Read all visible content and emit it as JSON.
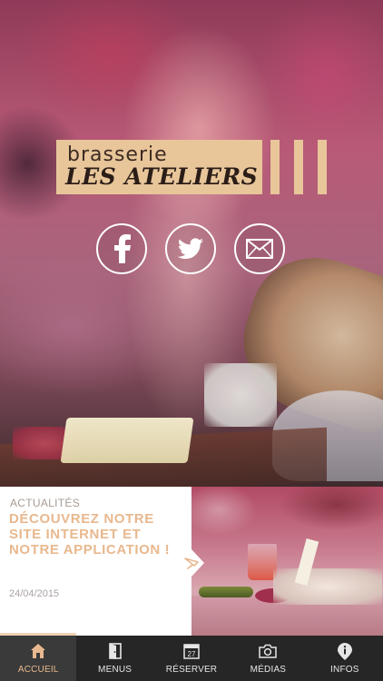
{
  "brand": {
    "small": "brasserie",
    "big": "LES ATELIERS"
  },
  "social": [
    {
      "icon": "facebook-icon"
    },
    {
      "icon": "twitter-icon"
    },
    {
      "icon": "mail-icon"
    }
  ],
  "news": {
    "category": "ACTUALITÉS",
    "title": "DÉCOUVREZ NOTRE SITE INTERNET ET NOTRE APPLICATION !",
    "date": "24/04/2015"
  },
  "tabs": [
    {
      "label": "ACCUEIL",
      "icon": "home-icon",
      "active": true
    },
    {
      "label": "MENUS",
      "icon": "menu-door-icon",
      "active": false
    },
    {
      "label": "RÉSERVER",
      "icon": "calendar-icon",
      "active": false,
      "calendar_day": "27"
    },
    {
      "label": "MÉDIAS",
      "icon": "camera-icon",
      "active": false
    },
    {
      "label": "INFOS",
      "icon": "info-icon",
      "active": false
    }
  ],
  "colors": {
    "accent": "#e8b88e",
    "logo_plate": "#e8c69a",
    "tabbar_bg": "#262626"
  }
}
